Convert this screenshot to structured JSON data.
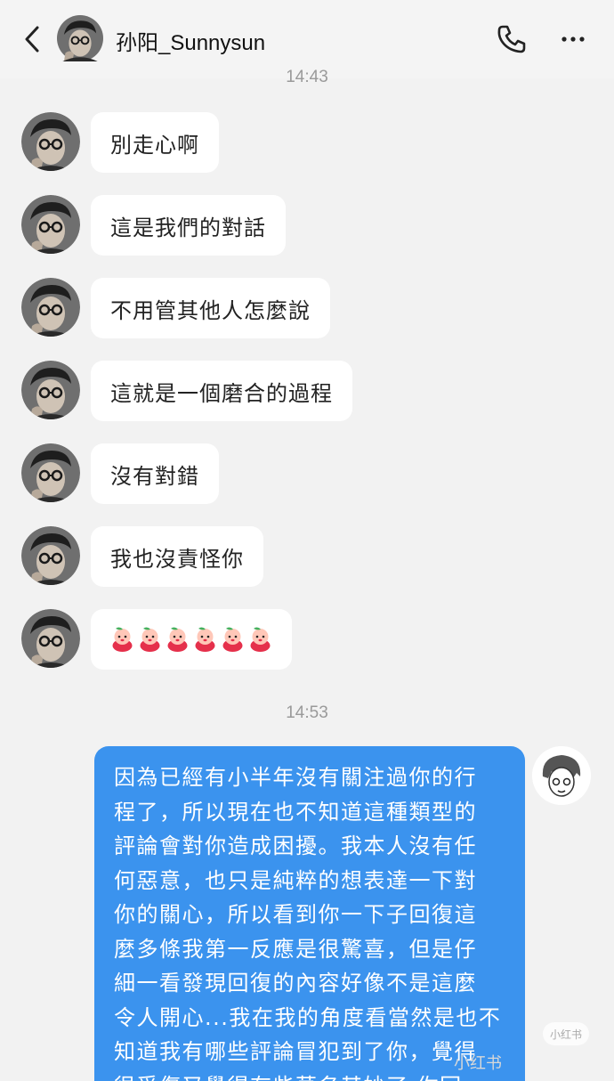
{
  "header": {
    "contact_name": "孙阳_Sunnysun",
    "back_icon": "chevron-left-icon",
    "call_icon": "phone-icon",
    "more_icon": "more-horizontal-icon"
  },
  "timestamps": [
    "14:43",
    "14:53"
  ],
  "received_messages": [
    "別走心啊",
    "這是我們的對話",
    "不用管其他人怎麼說",
    "這就是一個磨合的過程",
    "沒有對錯",
    "我也沒責怪你"
  ],
  "emoji_message": {
    "icon": "peach-sticker-icon",
    "count": 6
  },
  "sent_message": {
    "text": "因為已經有小半年沒有關注過你的行\n程了，所以現在也不知道這種類型的\n評論會對你造成困擾。我本人沒有任\n何惡意，也只是純粹的想表達一下對\n你的關心，所以看到你一下子回復這\n麼多條我第一反應是很驚喜，但是仔\n細一看發現回復的內容好像不是這麼\n令人開心...我在我的角度看當然是也不\n知道我有哪些評論冒犯到了你，覺得\n很受傷又覺得有些莫名其妙了 你回"
  },
  "watermark": {
    "badge": "小红书",
    "text": "小红书"
  },
  "colors": {
    "background": "#f2f2f2",
    "received_bubble": "#ffffff",
    "sent_bubble": "#3b93ee",
    "timestamp": "#9a9a9a"
  }
}
